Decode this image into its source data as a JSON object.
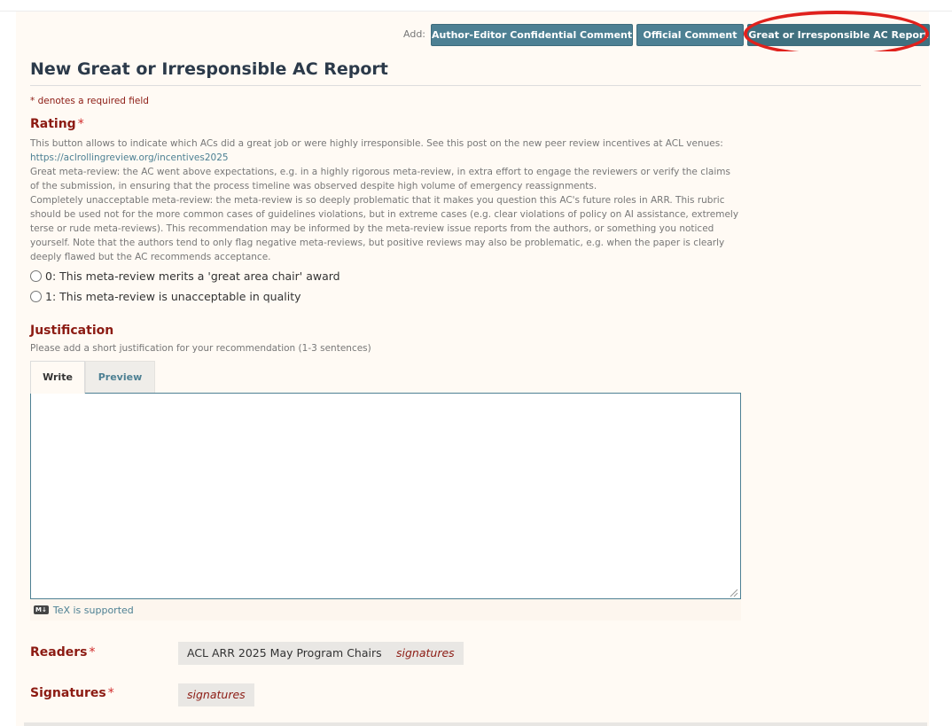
{
  "header": {
    "add_label": "Add:",
    "buttons": [
      {
        "label": "Author-Editor Confidential Comment"
      },
      {
        "label": "Official Comment"
      },
      {
        "label": "Great or Irresponsible AC Report"
      }
    ]
  },
  "form": {
    "title": "New Great or Irresponsible AC Report",
    "required_note": "* denotes a required field",
    "rating": {
      "label": "Rating",
      "star": "*",
      "intro": "This button allows to indicate which ACs did a great job or were highly irresponsible. See this post on the new peer review incentives at ACL venues:",
      "link": "https://aclrollingreview.org/incentives2025",
      "great": "Great meta-review: the AC went above expectations, e.g. in a highly rigorous meta-review, in extra effort to engage the reviewers or verify the claims of the submission, in ensuring that the process timeline was observed despite high volume of emergency reassignments.",
      "unacceptable": "Completely unacceptable meta-review: the meta-review is so deeply problematic that it makes you question this AC's future roles in ARR. This rubric should be used not for the more common cases of guidelines violations, but in extreme cases (e.g. clear violations of policy on AI assistance, extremely terse or rude meta-reviews). This recommendation may be informed by the meta-review issue reports from the authors, or something you noticed yourself. Note that the authors tend to only flag negative meta-reviews, but positive reviews may also be problematic, e.g. when the paper is clearly deeply flawed but the AC recommends acceptance.",
      "options": [
        {
          "label": "0: This meta-review merits a 'great area chair' award"
        },
        {
          "label": "1: This meta-review is unacceptable in quality"
        }
      ]
    },
    "justification": {
      "label": "Justification",
      "star": "*",
      "description": "Please add a short justification for your recommendation (1-3 sentences)",
      "tabs": [
        {
          "label": "Write"
        },
        {
          "label": "Preview"
        }
      ],
      "value": "",
      "tex_note": "TeX is supported",
      "md_badge": "M↓"
    },
    "readers": {
      "label": "Readers",
      "star": "*",
      "chips": [
        {
          "label": "ACL ARR 2025 May Program Chairs"
        },
        {
          "label": "signatures"
        }
      ]
    },
    "signatures": {
      "label": "Signatures",
      "star": "*",
      "chips": [
        {
          "label": "signatures"
        }
      ]
    }
  },
  "colors": {
    "accent": "#4d8093",
    "heading_red": "#8c1b13",
    "highlight": "#e0211c"
  }
}
